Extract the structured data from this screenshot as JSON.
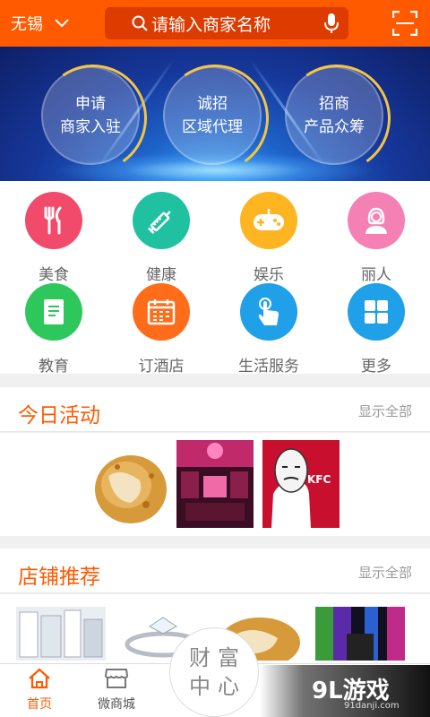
{
  "header": {
    "city": "无锡",
    "search_placeholder": "请输入商家名称",
    "accent": "#ff5a00"
  },
  "banner": {
    "buttons": [
      {
        "line1": "申请",
        "line2": "商家入驻"
      },
      {
        "line1": "诚招",
        "line2": "区域代理"
      },
      {
        "line1": "招商",
        "line2": "产品众筹"
      }
    ]
  },
  "categories": [
    {
      "label": "美食",
      "icon": "fork-knife-icon",
      "color": "#f24a6b"
    },
    {
      "label": "健康",
      "icon": "syringe-icon",
      "color": "#1fc1a0"
    },
    {
      "label": "娱乐",
      "icon": "gamepad-icon",
      "color": "#ffb521"
    },
    {
      "label": "丽人",
      "icon": "woman-icon",
      "color": "#f580b4"
    },
    {
      "label": "教育",
      "icon": "book-icon",
      "color": "#2dc75b"
    },
    {
      "label": "订酒店",
      "icon": "calendar-icon",
      "color": "#ff6d1a"
    },
    {
      "label": "生活服务",
      "icon": "tap-hand-icon",
      "color": "#1fa0e8"
    },
    {
      "label": "更多",
      "icon": "grid-icon",
      "color": "#1fa0e8"
    }
  ],
  "activities": {
    "title": "今日活动",
    "more": "显示全部",
    "thumb_logo": "KFC"
  },
  "shops": {
    "title": "店铺推荐",
    "more": "显示全部"
  },
  "center_button": {
    "line1": "财富",
    "line2": "中心"
  },
  "bottom_nav": [
    {
      "label": "首页",
      "icon": "home-icon"
    },
    {
      "label": "微商城",
      "icon": "store-icon"
    }
  ],
  "watermark": {
    "brand": "9L游戏",
    "site": "91danji.com"
  }
}
